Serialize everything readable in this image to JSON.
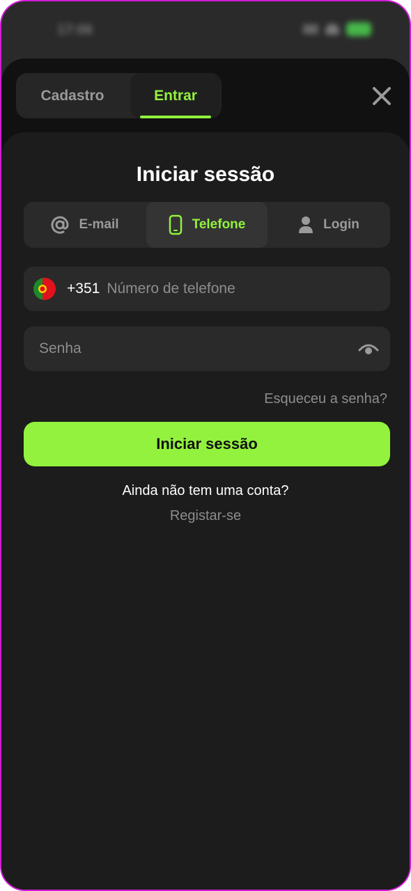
{
  "status_bar": {
    "time": "17:06"
  },
  "top_tabs": {
    "register_label": "Cadastro",
    "login_label": "Entrar"
  },
  "panel": {
    "title": "Iniciar sessão",
    "method_tabs": [
      {
        "label": "E-mail",
        "icon": "at-icon"
      },
      {
        "label": "Telefone",
        "icon": "phone-icon"
      },
      {
        "label": "Login",
        "icon": "user-icon"
      }
    ],
    "phone": {
      "country_code": "+351",
      "placeholder": "Número de telefone",
      "flag": "portugal-flag-icon"
    },
    "password": {
      "placeholder": "Senha",
      "toggle_icon": "eye-icon"
    },
    "forgot_label": "Esqueceu a senha?",
    "submit_label": "Iniciar sessão",
    "no_account_text": "Ainda não tem uma conta?",
    "register_label": "Registar-se"
  },
  "colors": {
    "accent": "#92f23d",
    "background": "#1c1c1c",
    "field": "#2a2a2a",
    "muted": "#8d8d8d"
  }
}
